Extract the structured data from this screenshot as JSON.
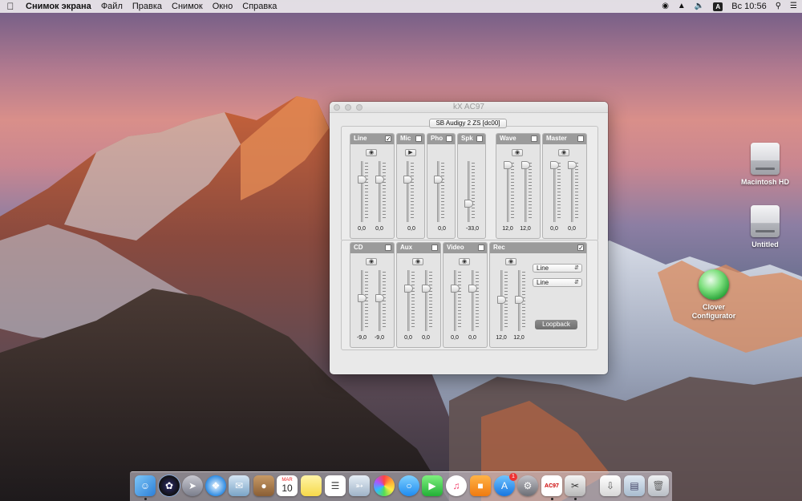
{
  "menubar": {
    "app_name": "Снимок экрана",
    "items": [
      "Файл",
      "Правка",
      "Снимок",
      "Окно",
      "Справка"
    ],
    "keyboard_layout": "A",
    "clock": "Вс 10:56"
  },
  "desktop_icons": [
    {
      "label": "Macintosh HD"
    },
    {
      "label": "Untitled"
    },
    {
      "label": "Clover Configurator"
    }
  ],
  "window": {
    "title": "kX AC97",
    "device": "SB Audigy 2 ZS [dc00]"
  },
  "mixer": {
    "channels": [
      {
        "name": "Line",
        "checked": true,
        "values": [
          "0,0",
          "0,0"
        ]
      },
      {
        "name": "Mic",
        "checked": false,
        "values": [
          "0,0"
        ]
      },
      {
        "name": "Pho",
        "checked": false,
        "values": [
          "0,0"
        ]
      },
      {
        "name": "Spk",
        "checked": false,
        "values": [
          "-33,0"
        ]
      },
      {
        "name": "Wave",
        "checked": false,
        "values": [
          "12,0",
          "12,0"
        ]
      },
      {
        "name": "Master",
        "checked": false,
        "values": [
          "0,0",
          "0,0"
        ]
      },
      {
        "name": "CD",
        "checked": false,
        "values": [
          "-9,0",
          "-9,0"
        ]
      },
      {
        "name": "Aux",
        "checked": false,
        "values": [
          "0,0",
          "0,0"
        ]
      },
      {
        "name": "Video",
        "checked": false,
        "values": [
          "0,0",
          "0,0"
        ]
      },
      {
        "name": "Rec",
        "checked": true,
        "values": [
          "12,0",
          "12,0"
        ]
      }
    ],
    "rec_source_left": "Line",
    "rec_source_right": "Line",
    "loopback_label": "Loopback"
  },
  "dock": {
    "calendar_month": "MAR",
    "calendar_day": "10",
    "appstore_badge": "1",
    "kx_icon_label": "AC97"
  },
  "colors": {
    "panel_header": "#9b9b9b",
    "window_bg": "#e9e9e9",
    "loopback_button": "#7a7a7a"
  }
}
